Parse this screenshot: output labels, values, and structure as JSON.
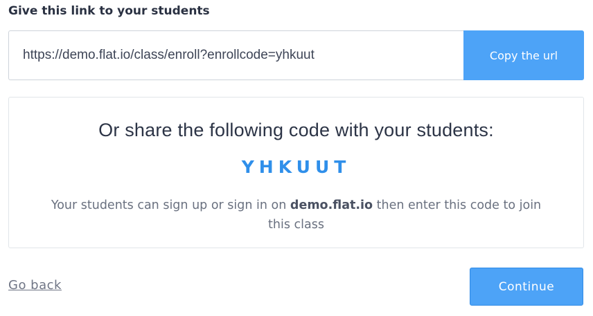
{
  "heading": "Give this link to your students",
  "url_field": {
    "value": "https://demo.flat.io/class/enroll?enrollcode=yhkuut"
  },
  "copy_button": {
    "label": "Copy the url"
  },
  "share": {
    "title": "Or share the following code with your students:",
    "code": "YHKUUT",
    "desc_prefix": "Your students can sign up or sign in on ",
    "desc_domain": "demo.flat.io",
    "desc_suffix": " then enter this code to join this class"
  },
  "footer": {
    "back_label": "Go back",
    "continue_label": "Continue"
  },
  "colors": {
    "accent": "#4da3f7",
    "code": "#2f8fea"
  }
}
